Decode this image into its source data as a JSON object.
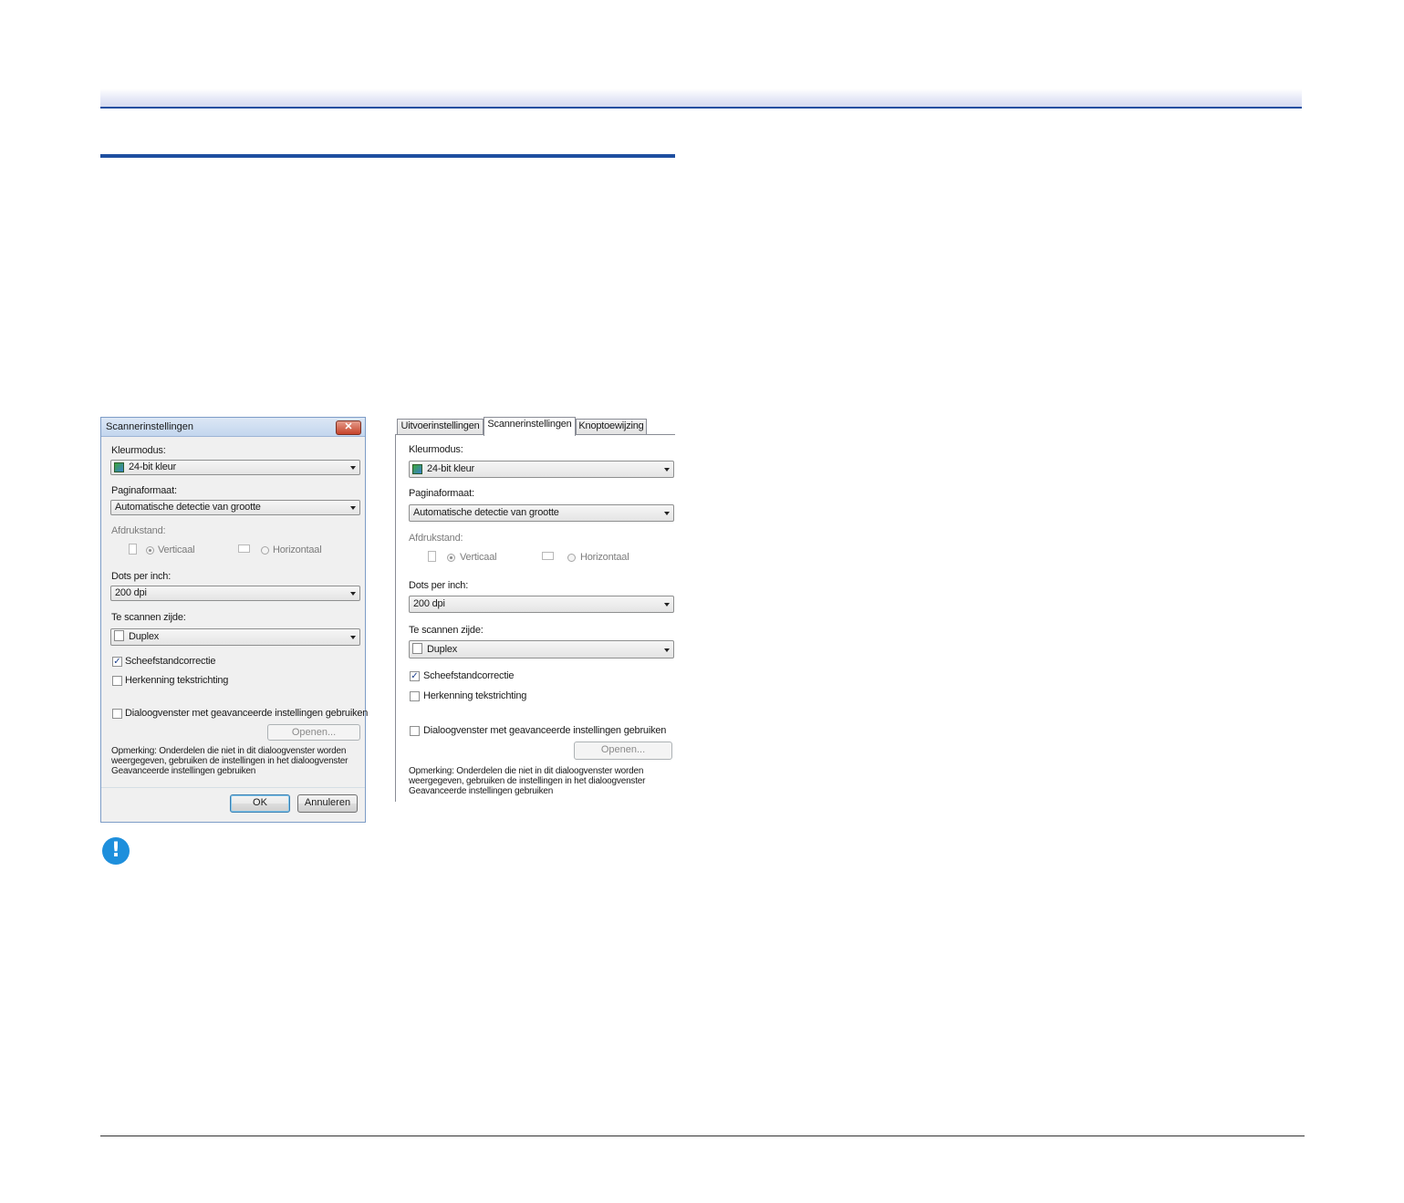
{
  "dialog": {
    "title": "Scannerinstellingen",
    "close_glyph": "✕",
    "color_mode_label": "Kleurmodus:",
    "color_mode_value": "24-bit kleur",
    "page_size_label": "Paginaformaat:",
    "page_size_value": "Automatische detectie van grootte",
    "orientation_label": "Afdrukstand:",
    "portrait_label": "Verticaal",
    "landscape_label": "Horizontaal",
    "dpi_label": "Dots per inch:",
    "dpi_value": "200 dpi",
    "side_label": "Te scannen zijde:",
    "side_value": "Duplex",
    "deskew_label": "Scheefstandcorrectie",
    "deskew_checked": true,
    "text_orientation_label": "Herkenning tekstrichting",
    "text_orientation_checked": false,
    "advanced_label": "Dialoogvenster met geavanceerde instellingen gebruiken",
    "advanced_checked": false,
    "open_button": "Openen...",
    "note": "Opmerking: Onderdelen die niet in dit dialoogvenster worden weergegeven, gebruiken de instellingen in het dialoogvenster Geavanceerde instellingen gebruiken",
    "ok_button": "OK",
    "cancel_button": "Annuleren"
  },
  "tabbed_panel": {
    "tabs": [
      "Uitvoerinstellingen",
      "Scannerinstellingen",
      "Knoptoewijzing"
    ],
    "active_tab": "Scannerinstellingen",
    "color_mode_label": "Kleurmodus:",
    "color_mode_value": "24-bit kleur",
    "page_size_label": "Paginaformaat:",
    "page_size_value": "Automatische detectie van grootte",
    "orientation_label": "Afdrukstand:",
    "portrait_label": "Verticaal",
    "landscape_label": "Horizontaal",
    "dpi_label": "Dots per inch:",
    "dpi_value": "200 dpi",
    "side_label": "Te scannen zijde:",
    "side_value": "Duplex",
    "deskew_label": "Scheefstandcorrectie",
    "deskew_checked": true,
    "text_orientation_label": "Herkenning tekstrichting",
    "text_orientation_checked": false,
    "advanced_label": "Dialoogvenster met geavanceerde instellingen gebruiken",
    "advanced_checked": false,
    "open_button": "Openen...",
    "note": "Opmerking: Onderdelen die niet in dit dialoogvenster worden weergegeven, gebruiken de instellingen in het dialoogvenster Geavanceerde instellingen gebruiken"
  },
  "alert": {
    "glyph": "!"
  },
  "colors": {
    "accent_rule": "#1e4fa0",
    "alert_blue": "#1e8fdc"
  }
}
